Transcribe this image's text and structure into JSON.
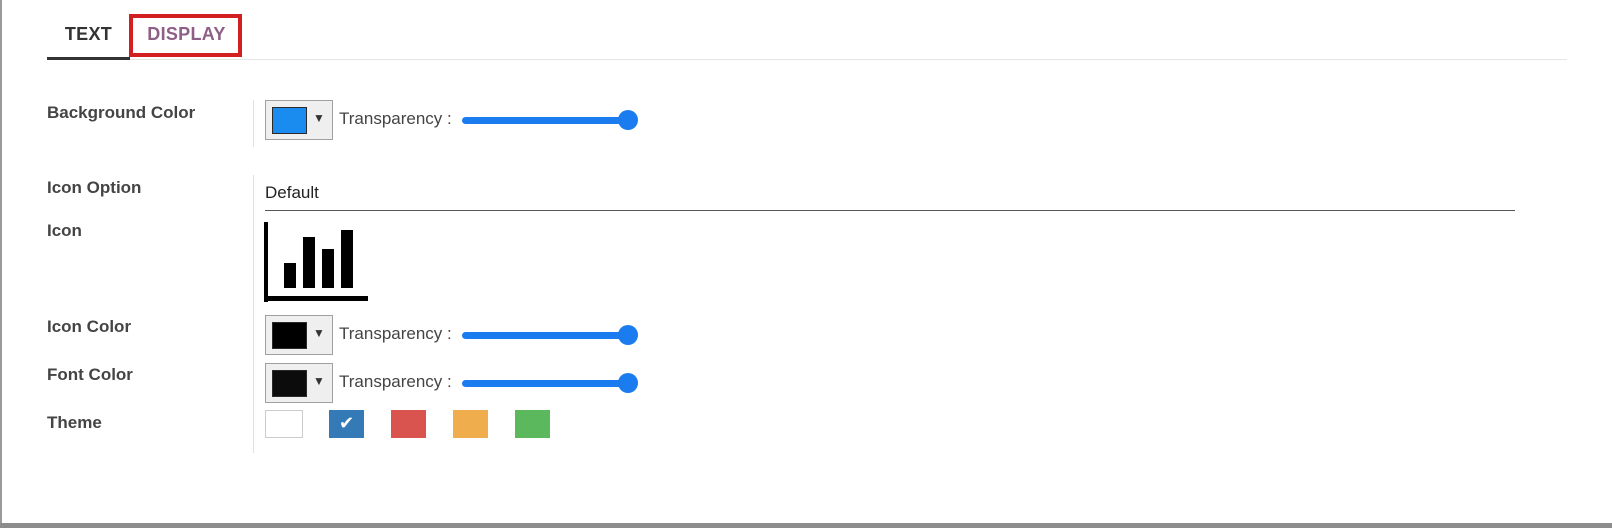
{
  "tabs": [
    {
      "label": "TEXT",
      "active": true
    },
    {
      "label": "DISPLAY",
      "active": false
    }
  ],
  "background_color": {
    "label": "Background Color",
    "swatch_color": "#1a8cf0",
    "transparency_label": "Transparency :",
    "transparency_value": 1.0
  },
  "icon_option": {
    "label": "Icon Option",
    "value": "Default"
  },
  "icon": {
    "label": "Icon",
    "name": "bar-chart-icon"
  },
  "icon_color": {
    "label": "Icon Color",
    "swatch_color": "#000000",
    "transparency_label": "Transparency :",
    "transparency_value": 1.0
  },
  "font_color": {
    "label": "Font Color",
    "swatch_color": "#0c0c0c",
    "transparency_label": "Transparency :",
    "transparency_value": 1.0
  },
  "theme": {
    "label": "Theme",
    "options": [
      {
        "name": "white",
        "color": "#ffffff",
        "selected": false,
        "mark": ""
      },
      {
        "name": "blue",
        "color": "#337ab7",
        "selected": true,
        "mark": "✔"
      },
      {
        "name": "red",
        "color": "#d9534f",
        "selected": false,
        "mark": ""
      },
      {
        "name": "orange",
        "color": "#f0ad4e",
        "selected": false,
        "mark": ""
      },
      {
        "name": "green",
        "color": "#5cb85c",
        "selected": false,
        "mark": ""
      }
    ]
  },
  "colors": {
    "accent": "#1b7cf0",
    "tab_inactive": "#8e5f86",
    "highlight": "#d21f1f"
  }
}
